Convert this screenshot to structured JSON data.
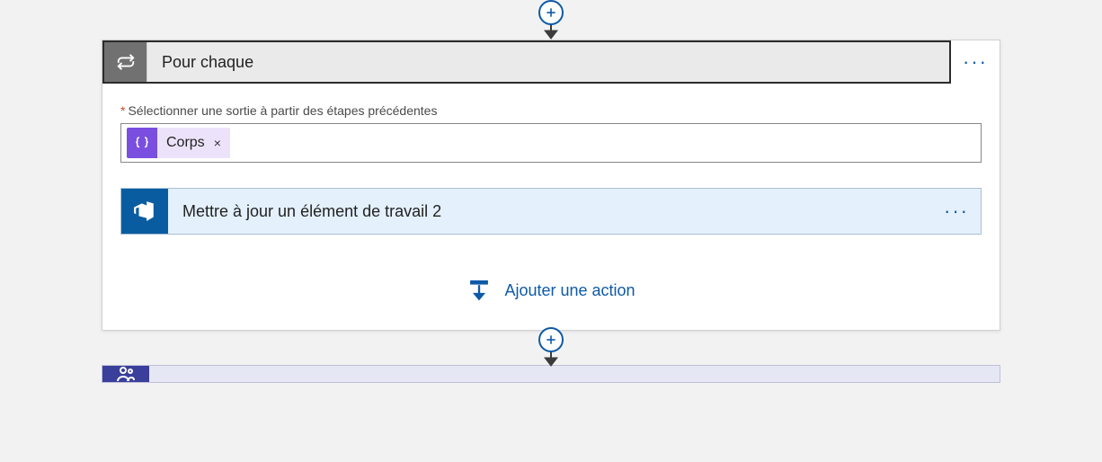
{
  "connector": {
    "add_label": "+"
  },
  "foreach": {
    "title": "Pour chaque",
    "menu_label": "···",
    "select_output_label": "Sélectionner une sortie à partir des étapes précédentes",
    "required_marker": "*",
    "token": {
      "name": "Corps",
      "remove": "×"
    },
    "inner_action": {
      "title": "Mettre à jour un élément de travail 2",
      "menu_label": "···"
    },
    "add_action_label": "Ajouter une action"
  }
}
